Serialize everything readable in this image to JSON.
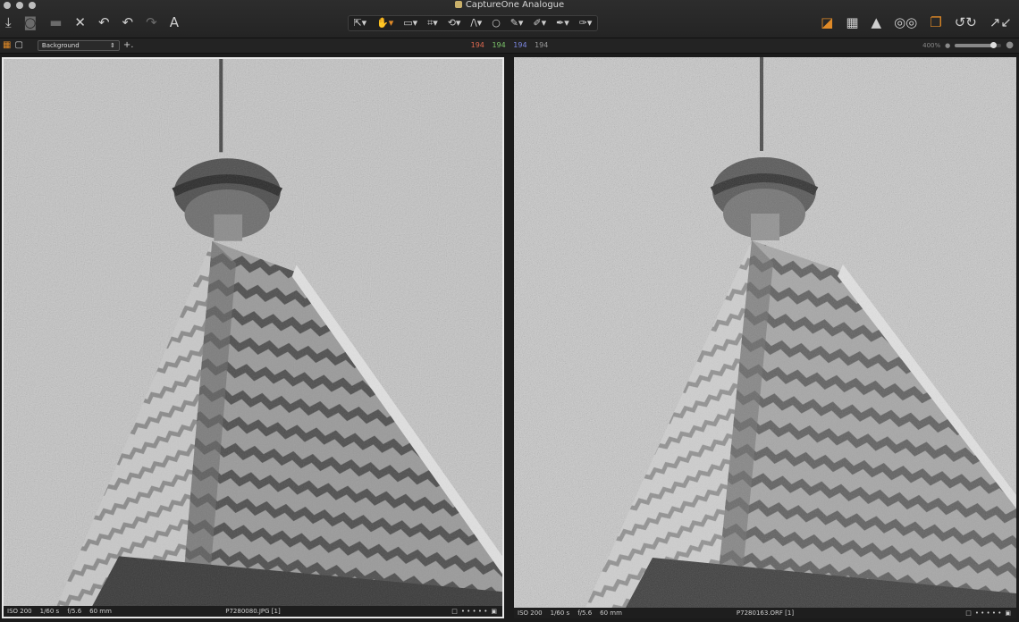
{
  "window": {
    "title": "CaptureOne Analogue"
  },
  "toolbar_left": [
    {
      "name": "import-icon",
      "glyph": "⤓"
    },
    {
      "name": "camera-icon",
      "glyph": "◙",
      "dim": true
    },
    {
      "name": "folder-icon",
      "glyph": "▬",
      "dim": true
    },
    {
      "name": "delete-icon",
      "glyph": "✕"
    },
    {
      "name": "undo-icon",
      "glyph": "↶"
    },
    {
      "name": "redo-left-icon",
      "glyph": "↶"
    },
    {
      "name": "redo-icon",
      "glyph": "↷",
      "dim": true
    },
    {
      "name": "text-icon",
      "glyph": "A"
    }
  ],
  "toolbar_center": [
    {
      "name": "select-tool-icon",
      "glyph": "⇱▾"
    },
    {
      "name": "pan-tool-icon",
      "glyph": "✋▾",
      "active": true
    },
    {
      "name": "loupe-tool-icon",
      "glyph": "▭▾"
    },
    {
      "name": "crop-tool-icon",
      "glyph": "⌗▾"
    },
    {
      "name": "rotate-tool-icon",
      "glyph": "⟲▾"
    },
    {
      "name": "keystone-tool-icon",
      "glyph": "/\\▾"
    },
    {
      "name": "spot-tool-icon",
      "glyph": "○"
    },
    {
      "name": "brush-tool-icon",
      "glyph": "✎▾"
    },
    {
      "name": "eraser-tool-icon",
      "glyph": "✐▾"
    },
    {
      "name": "gradient-tool-icon",
      "glyph": "✒▾"
    },
    {
      "name": "picker-tool-icon",
      "glyph": "✑▾"
    }
  ],
  "toolbar_right": [
    {
      "name": "exposure-warning-icon",
      "glyph": "◪",
      "orange": true
    },
    {
      "name": "grid-icon",
      "glyph": "▦"
    },
    {
      "name": "warning-icon",
      "glyph": "▲"
    },
    {
      "name": "proof-glasses-icon",
      "glyph": "◎◎"
    },
    {
      "name": "copy-icon",
      "glyph": "❐",
      "orange": true
    },
    {
      "name": "reset-icon",
      "glyph": "↺↻"
    },
    {
      "name": "copy-adjust-icon",
      "glyph": "↗↙"
    }
  ],
  "subbar": {
    "layer": "Background",
    "readout": {
      "r": "194",
      "g": "194",
      "b": "194",
      "l": "194"
    },
    "zoom": "400%",
    "zoom_level": 0.85
  },
  "colors": {
    "r": "#e06a50",
    "g": "#7cc56a",
    "b": "#7b86e0",
    "l": "#9a9a9a",
    "accent": "#e08a27"
  },
  "panes": [
    {
      "iso": "ISO 200",
      "shutter": "1/60 s",
      "aperture": "f/5.6",
      "focal": "60 mm",
      "file": "P7280080.JPG [1]"
    },
    {
      "iso": "ISO 200",
      "shutter": "1/60 s",
      "aperture": "f/5.6",
      "focal": "60 mm",
      "file": "P7280163.ORF [1]"
    }
  ]
}
